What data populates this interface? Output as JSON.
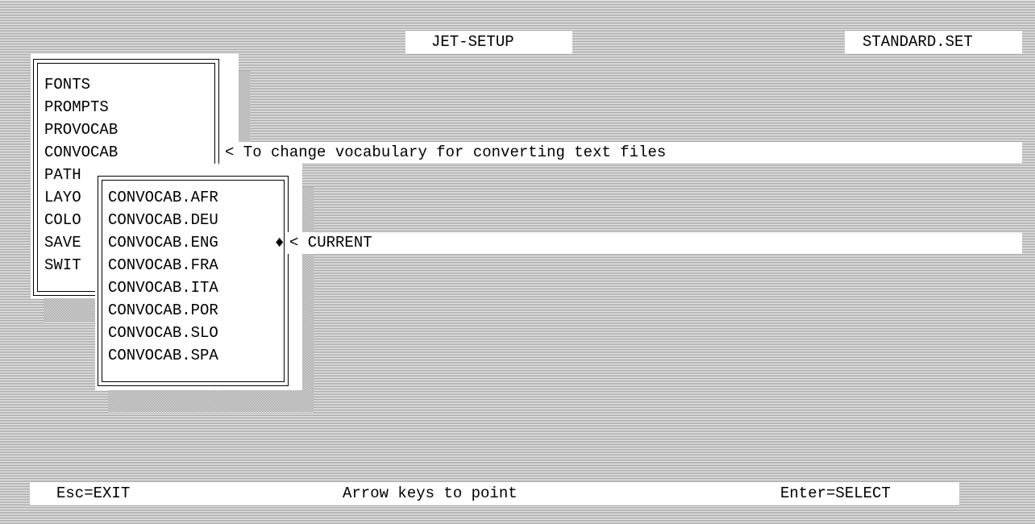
{
  "header": {
    "title": "JET-SETUP",
    "file": "STANDARD.SET"
  },
  "main_menu": {
    "items": [
      "FONTS",
      "PROMPTS",
      "PROVOCAB",
      "CONVOCAB",
      "PATH",
      "LAYO",
      "COLO",
      "SAVE",
      "SWIT"
    ],
    "highlighted_hint": "< To change vocabulary for converting text files"
  },
  "submenu": {
    "items": [
      "CONVOCAB.AFR",
      "CONVOCAB.DEU",
      "CONVOCAB.ENG",
      "CONVOCAB.FRA",
      "CONVOCAB.ITA",
      "CONVOCAB.POR",
      "CONVOCAB.SLO",
      "CONVOCAB.SPA"
    ],
    "current_marker": "♦",
    "current_hint": "< CURRENT"
  },
  "status_bar": {
    "exit": "Esc=EXIT",
    "point": "Arrow keys to point",
    "select": "Enter=SELECT"
  }
}
